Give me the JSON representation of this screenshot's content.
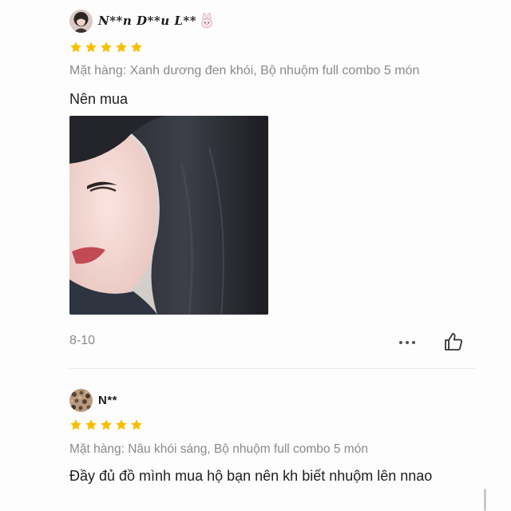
{
  "reviews": [
    {
      "username": "N**n D**u L**",
      "rating": 5,
      "variant": "Mặt hàng: Xanh dương đen khói, Bộ nhuộm full combo 5 món",
      "comment": "Nên mua",
      "date": "8-10",
      "avatar_icon": "girl-avatar",
      "username_emoji": "bunny-icon"
    },
    {
      "username": "N**",
      "rating": 5,
      "variant": "Mặt hàng: Nâu khói sáng, Bộ nhuộm full combo 5 món",
      "comment": "Đầy đủ đồ mình mua hộ bạn nên kh biết nhuộm lên nnao",
      "avatar_icon": "leopard-pattern-avatar"
    }
  ],
  "icons": {
    "star_color": "#f6c000",
    "more": "more-dots-icon",
    "like": "thumbs-up-icon"
  }
}
